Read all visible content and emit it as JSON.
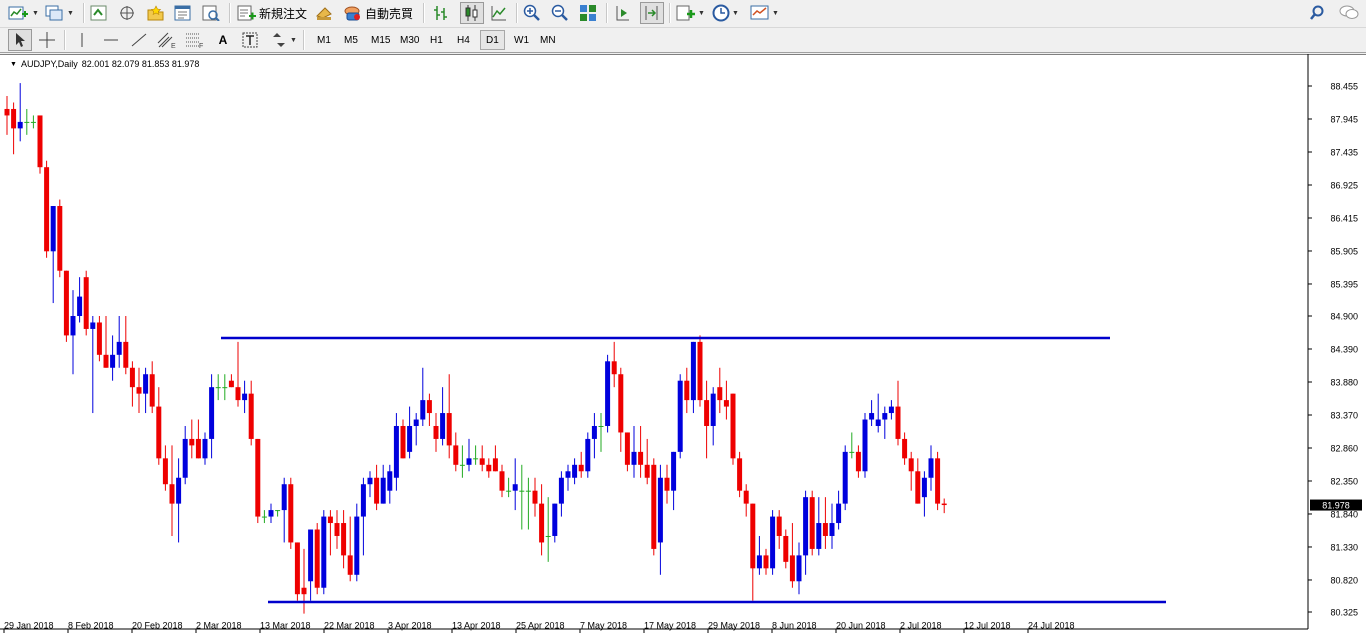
{
  "toolbar_main": {
    "new_order_label": "新規注文",
    "auto_trading_label": "自動売買",
    "icons": [
      "new-chart-icon",
      "profiles-icon",
      "market-watch-icon",
      "navigator-icon",
      "favorites-icon",
      "data-window-icon",
      "strategy-tester-icon",
      "new-order-icon",
      "metaeditor-icon",
      "auto-trading-icon",
      "bar-chart-icon",
      "candlestick-icon",
      "line-chart-icon",
      "zoom-in-icon",
      "zoom-out-icon",
      "tile-windows-icon",
      "chart-shift-icon",
      "autoscroll-icon",
      "indicators-icon",
      "periods-icon",
      "templates-icon",
      "search-icon",
      "chat-icon"
    ]
  },
  "toolbar_draw": {
    "tool_text_label": "A",
    "timeframes": [
      "M1",
      "M5",
      "M15",
      "M30",
      "H1",
      "H4",
      "D1",
      "W1",
      "MN"
    ],
    "active_timeframe": "D1"
  },
  "chart": {
    "symbol_info": "AUDJPY,Daily",
    "ohlc_text": "82.001 82.079 81.853 81.978",
    "current_price": "81.978",
    "colors": {
      "bull": "#0000dd",
      "bear": "#ee0000",
      "doji": "#22aa22",
      "line": "#0000cc"
    }
  },
  "chart_data": {
    "type": "candlestick",
    "symbol": "AUDJPY",
    "timeframe": "Daily",
    "y_ticks": [
      "88.455",
      "87.945",
      "87.435",
      "86.925",
      "86.415",
      "85.905",
      "85.395",
      "84.900",
      "84.390",
      "83.880",
      "83.370",
      "82.860",
      "82.350",
      "81.840",
      "81.330",
      "80.820",
      "80.325"
    ],
    "x_ticks": [
      "29 Jan 2018",
      "8 Feb 2018",
      "20 Feb 2018",
      "2 Mar 2018",
      "13 Mar 2018",
      "22 Mar 2018",
      "3 Apr 2018",
      "13 Apr 2018",
      "25 Apr 2018",
      "7 May 2018",
      "17 May 2018",
      "29 May 2018",
      "8 Jun 2018",
      "20 Jun 2018",
      "2 Jul 2018",
      "12 Jul 2018",
      "24 Jul 2018"
    ],
    "ylim": [
      80.325,
      88.455
    ],
    "resistance_level": 84.56,
    "support_level": 80.48,
    "candles": [
      {
        "o": 88.1,
        "h": 88.3,
        "l": 87.7,
        "c": 88.0
      },
      {
        "o": 88.1,
        "h": 88.2,
        "l": 87.4,
        "c": 87.8
      },
      {
        "o": 87.8,
        "h": 88.5,
        "l": 87.6,
        "c": 87.9
      },
      {
        "o": 87.9,
        "h": 88.1,
        "l": 87.7,
        "c": 87.9
      },
      {
        "o": 87.9,
        "h": 88.0,
        "l": 87.8,
        "c": 87.9
      },
      {
        "o": 88.0,
        "h": 88.0,
        "l": 87.1,
        "c": 87.2
      },
      {
        "o": 87.2,
        "h": 87.3,
        "l": 85.8,
        "c": 85.9
      },
      {
        "o": 85.9,
        "h": 86.6,
        "l": 85.1,
        "c": 86.6
      },
      {
        "o": 86.6,
        "h": 86.7,
        "l": 85.5,
        "c": 85.6
      },
      {
        "o": 85.6,
        "h": 85.6,
        "l": 84.5,
        "c": 84.6
      },
      {
        "o": 84.6,
        "h": 85.3,
        "l": 84.0,
        "c": 84.9
      },
      {
        "o": 84.9,
        "h": 85.5,
        "l": 84.8,
        "c": 85.2
      },
      {
        "o": 85.5,
        "h": 85.6,
        "l": 84.6,
        "c": 84.7
      },
      {
        "o": 84.7,
        "h": 84.9,
        "l": 83.4,
        "c": 84.8
      },
      {
        "o": 84.8,
        "h": 84.9,
        "l": 84.2,
        "c": 84.3
      },
      {
        "o": 84.3,
        "h": 84.9,
        "l": 84.1,
        "c": 84.1
      },
      {
        "o": 84.1,
        "h": 84.6,
        "l": 83.9,
        "c": 84.3
      },
      {
        "o": 84.3,
        "h": 84.9,
        "l": 84.1,
        "c": 84.5
      },
      {
        "o": 84.5,
        "h": 84.9,
        "l": 84.0,
        "c": 84.1
      },
      {
        "o": 84.1,
        "h": 84.2,
        "l": 83.5,
        "c": 83.8
      },
      {
        "o": 83.8,
        "h": 84.1,
        "l": 83.4,
        "c": 83.7
      },
      {
        "o": 83.7,
        "h": 84.1,
        "l": 83.4,
        "c": 84.0
      },
      {
        "o": 84.0,
        "h": 84.2,
        "l": 83.4,
        "c": 83.5
      },
      {
        "o": 83.5,
        "h": 83.8,
        "l": 82.6,
        "c": 82.7
      },
      {
        "o": 82.7,
        "h": 82.9,
        "l": 82.2,
        "c": 82.3
      },
      {
        "o": 82.3,
        "h": 82.9,
        "l": 81.5,
        "c": 82.0
      },
      {
        "o": 82.0,
        "h": 82.7,
        "l": 81.4,
        "c": 82.4
      },
      {
        "o": 82.4,
        "h": 83.2,
        "l": 82.3,
        "c": 83.0
      },
      {
        "o": 83.0,
        "h": 83.3,
        "l": 82.7,
        "c": 82.9
      },
      {
        "o": 83.0,
        "h": 83.3,
        "l": 82.7,
        "c": 82.7
      },
      {
        "o": 82.7,
        "h": 83.1,
        "l": 82.6,
        "c": 83.0
      },
      {
        "o": 83.0,
        "h": 84.0,
        "l": 82.7,
        "c": 83.8
      },
      {
        "o": 83.8,
        "h": 84.0,
        "l": 83.6,
        "c": 83.8
      },
      {
        "o": 83.8,
        "h": 84.0,
        "l": 83.6,
        "c": 83.8
      },
      {
        "o": 83.9,
        "h": 84.0,
        "l": 83.8,
        "c": 83.8
      },
      {
        "o": 83.8,
        "h": 84.5,
        "l": 83.5,
        "c": 83.6
      },
      {
        "o": 83.6,
        "h": 83.9,
        "l": 83.4,
        "c": 83.7
      },
      {
        "o": 83.7,
        "h": 83.9,
        "l": 82.9,
        "c": 83.0
      },
      {
        "o": 83.0,
        "h": 83.0,
        "l": 81.7,
        "c": 81.8
      },
      {
        "o": 81.8,
        "h": 81.9,
        "l": 81.7,
        "c": 81.8
      },
      {
        "o": 81.8,
        "h": 82.0,
        "l": 81.7,
        "c": 81.9
      },
      {
        "o": 81.9,
        "h": 81.9,
        "l": 81.8,
        "c": 81.9
      },
      {
        "o": 81.9,
        "h": 82.4,
        "l": 81.4,
        "c": 82.3
      },
      {
        "o": 82.3,
        "h": 82.4,
        "l": 81.3,
        "c": 81.4
      },
      {
        "o": 81.4,
        "h": 81.4,
        "l": 80.5,
        "c": 80.6
      },
      {
        "o": 80.7,
        "h": 81.3,
        "l": 80.3,
        "c": 80.6
      },
      {
        "o": 80.8,
        "h": 81.6,
        "l": 80.5,
        "c": 81.6
      },
      {
        "o": 81.6,
        "h": 81.7,
        "l": 80.6,
        "c": 80.7
      },
      {
        "o": 80.7,
        "h": 81.9,
        "l": 80.6,
        "c": 81.8
      },
      {
        "o": 81.8,
        "h": 81.9,
        "l": 81.2,
        "c": 81.7
      },
      {
        "o": 81.7,
        "h": 81.9,
        "l": 81.3,
        "c": 81.5
      },
      {
        "o": 81.7,
        "h": 81.9,
        "l": 81.0,
        "c": 81.2
      },
      {
        "o": 81.2,
        "h": 81.8,
        "l": 80.8,
        "c": 80.9
      },
      {
        "o": 80.9,
        "h": 82.0,
        "l": 80.8,
        "c": 81.8
      },
      {
        "o": 81.8,
        "h": 82.4,
        "l": 81.2,
        "c": 82.3
      },
      {
        "o": 82.3,
        "h": 82.5,
        "l": 82.1,
        "c": 82.4
      },
      {
        "o": 82.4,
        "h": 82.6,
        "l": 81.9,
        "c": 82.0
      },
      {
        "o": 82.0,
        "h": 82.6,
        "l": 82.0,
        "c": 82.4
      },
      {
        "o": 82.2,
        "h": 82.6,
        "l": 82.0,
        "c": 82.5
      },
      {
        "o": 82.4,
        "h": 83.4,
        "l": 82.2,
        "c": 83.2
      },
      {
        "o": 83.2,
        "h": 83.3,
        "l": 82.7,
        "c": 82.7
      },
      {
        "o": 82.8,
        "h": 83.5,
        "l": 82.7,
        "c": 83.2
      },
      {
        "o": 83.2,
        "h": 83.4,
        "l": 82.9,
        "c": 83.3
      },
      {
        "o": 83.3,
        "h": 84.1,
        "l": 83.2,
        "c": 83.6
      },
      {
        "o": 83.6,
        "h": 83.7,
        "l": 83.2,
        "c": 83.4
      },
      {
        "o": 83.2,
        "h": 83.4,
        "l": 82.8,
        "c": 83.0
      },
      {
        "o": 83.0,
        "h": 83.8,
        "l": 82.9,
        "c": 83.4
      },
      {
        "o": 83.4,
        "h": 84.0,
        "l": 82.7,
        "c": 82.9
      },
      {
        "o": 82.9,
        "h": 83.1,
        "l": 82.5,
        "c": 82.6
      },
      {
        "o": 82.6,
        "h": 82.9,
        "l": 82.4,
        "c": 82.6
      },
      {
        "o": 82.6,
        "h": 83.0,
        "l": 82.5,
        "c": 82.7
      },
      {
        "o": 82.7,
        "h": 82.9,
        "l": 82.6,
        "c": 82.7
      },
      {
        "o": 82.7,
        "h": 82.9,
        "l": 82.5,
        "c": 82.6
      },
      {
        "o": 82.6,
        "h": 82.7,
        "l": 82.4,
        "c": 82.5
      },
      {
        "o": 82.7,
        "h": 82.9,
        "l": 82.5,
        "c": 82.5
      },
      {
        "o": 82.5,
        "h": 82.6,
        "l": 82.1,
        "c": 82.2
      },
      {
        "o": 82.2,
        "h": 82.4,
        "l": 82.1,
        "c": 82.2
      },
      {
        "o": 82.2,
        "h": 82.7,
        "l": 81.9,
        "c": 82.3
      },
      {
        "o": 82.2,
        "h": 82.6,
        "l": 81.6,
        "c": 82.2
      },
      {
        "o": 82.2,
        "h": 82.4,
        "l": 81.6,
        "c": 82.2
      },
      {
        "o": 82.2,
        "h": 82.4,
        "l": 81.8,
        "c": 82.0
      },
      {
        "o": 82.0,
        "h": 82.3,
        "l": 81.2,
        "c": 81.4
      },
      {
        "o": 81.5,
        "h": 82.1,
        "l": 81.1,
        "c": 81.5
      },
      {
        "o": 81.5,
        "h": 82.0,
        "l": 81.4,
        "c": 82.0
      },
      {
        "o": 82.0,
        "h": 82.5,
        "l": 81.8,
        "c": 82.4
      },
      {
        "o": 82.4,
        "h": 82.6,
        "l": 82.2,
        "c": 82.5
      },
      {
        "o": 82.4,
        "h": 82.7,
        "l": 82.3,
        "c": 82.6
      },
      {
        "o": 82.6,
        "h": 82.8,
        "l": 82.4,
        "c": 82.5
      },
      {
        "o": 82.5,
        "h": 83.1,
        "l": 82.4,
        "c": 83.0
      },
      {
        "o": 83.0,
        "h": 83.4,
        "l": 82.7,
        "c": 83.2
      },
      {
        "o": 83.2,
        "h": 83.4,
        "l": 82.8,
        "c": 83.2
      },
      {
        "o": 83.2,
        "h": 84.3,
        "l": 83.1,
        "c": 84.2
      },
      {
        "o": 84.2,
        "h": 84.5,
        "l": 83.8,
        "c": 84.0
      },
      {
        "o": 84.0,
        "h": 84.1,
        "l": 82.8,
        "c": 83.1
      },
      {
        "o": 83.1,
        "h": 83.1,
        "l": 82.5,
        "c": 82.6
      },
      {
        "o": 82.6,
        "h": 83.2,
        "l": 82.4,
        "c": 82.8
      },
      {
        "o": 82.8,
        "h": 83.2,
        "l": 82.4,
        "c": 82.6
      },
      {
        "o": 82.6,
        "h": 83.0,
        "l": 82.3,
        "c": 82.4
      },
      {
        "o": 82.6,
        "h": 82.7,
        "l": 81.2,
        "c": 81.3
      },
      {
        "o": 81.4,
        "h": 82.6,
        "l": 80.9,
        "c": 82.4
      },
      {
        "o": 82.4,
        "h": 82.6,
        "l": 82.0,
        "c": 82.2
      },
      {
        "o": 82.2,
        "h": 82.8,
        "l": 81.9,
        "c": 82.8
      },
      {
        "o": 82.8,
        "h": 84.0,
        "l": 82.7,
        "c": 83.9
      },
      {
        "o": 83.9,
        "h": 84.1,
        "l": 83.4,
        "c": 83.6
      },
      {
        "o": 83.6,
        "h": 84.5,
        "l": 83.4,
        "c": 84.5
      },
      {
        "o": 84.5,
        "h": 84.6,
        "l": 83.5,
        "c": 83.6
      },
      {
        "o": 83.6,
        "h": 83.9,
        "l": 82.7,
        "c": 83.2
      },
      {
        "o": 83.2,
        "h": 83.8,
        "l": 82.9,
        "c": 83.7
      },
      {
        "o": 83.8,
        "h": 84.1,
        "l": 83.4,
        "c": 83.6
      },
      {
        "o": 83.6,
        "h": 83.9,
        "l": 83.3,
        "c": 83.5
      },
      {
        "o": 83.7,
        "h": 83.7,
        "l": 82.6,
        "c": 82.7
      },
      {
        "o": 82.7,
        "h": 82.8,
        "l": 82.1,
        "c": 82.2
      },
      {
        "o": 82.2,
        "h": 82.3,
        "l": 81.8,
        "c": 82.0
      },
      {
        "o": 82.0,
        "h": 82.0,
        "l": 80.5,
        "c": 81.0
      },
      {
        "o": 81.0,
        "h": 81.5,
        "l": 80.9,
        "c": 81.2
      },
      {
        "o": 81.2,
        "h": 81.3,
        "l": 80.9,
        "c": 81.0
      },
      {
        "o": 81.0,
        "h": 81.9,
        "l": 80.9,
        "c": 81.8
      },
      {
        "o": 81.8,
        "h": 81.9,
        "l": 81.3,
        "c": 81.5
      },
      {
        "o": 81.5,
        "h": 81.6,
        "l": 81.0,
        "c": 81.1
      },
      {
        "o": 81.2,
        "h": 81.7,
        "l": 80.7,
        "c": 80.8
      },
      {
        "o": 80.8,
        "h": 81.4,
        "l": 80.6,
        "c": 81.2
      },
      {
        "o": 81.2,
        "h": 82.2,
        "l": 80.9,
        "c": 82.1
      },
      {
        "o": 82.1,
        "h": 82.2,
        "l": 81.2,
        "c": 81.3
      },
      {
        "o": 81.3,
        "h": 82.1,
        "l": 81.2,
        "c": 81.7
      },
      {
        "o": 81.7,
        "h": 82.1,
        "l": 81.3,
        "c": 81.5
      },
      {
        "o": 81.5,
        "h": 82.0,
        "l": 81.3,
        "c": 81.7
      },
      {
        "o": 81.7,
        "h": 82.2,
        "l": 81.6,
        "c": 82.0
      },
      {
        "o": 82.0,
        "h": 82.9,
        "l": 81.9,
        "c": 82.8
      },
      {
        "o": 82.8,
        "h": 83.1,
        "l": 82.7,
        "c": 82.8
      },
      {
        "o": 82.8,
        "h": 82.9,
        "l": 82.4,
        "c": 82.5
      },
      {
        "o": 82.5,
        "h": 83.4,
        "l": 82.4,
        "c": 83.3
      },
      {
        "o": 83.3,
        "h": 83.6,
        "l": 83.2,
        "c": 83.4
      },
      {
        "o": 83.2,
        "h": 83.7,
        "l": 83.1,
        "c": 83.3
      },
      {
        "o": 83.3,
        "h": 83.5,
        "l": 83.0,
        "c": 83.4
      },
      {
        "o": 83.4,
        "h": 83.6,
        "l": 83.3,
        "c": 83.5
      },
      {
        "o": 83.5,
        "h": 83.9,
        "l": 82.9,
        "c": 83.0
      },
      {
        "o": 83.0,
        "h": 83.1,
        "l": 82.6,
        "c": 82.7
      },
      {
        "o": 82.7,
        "h": 82.8,
        "l": 82.2,
        "c": 82.5
      },
      {
        "o": 82.5,
        "h": 82.7,
        "l": 82.0,
        "c": 82.0
      },
      {
        "o": 82.1,
        "h": 82.5,
        "l": 81.8,
        "c": 82.4
      },
      {
        "o": 82.4,
        "h": 82.9,
        "l": 82.2,
        "c": 82.7
      },
      {
        "o": 82.7,
        "h": 82.8,
        "l": 81.9,
        "c": 82.0
      },
      {
        "o": 82.001,
        "h": 82.079,
        "l": 81.853,
        "c": 81.978
      }
    ]
  }
}
